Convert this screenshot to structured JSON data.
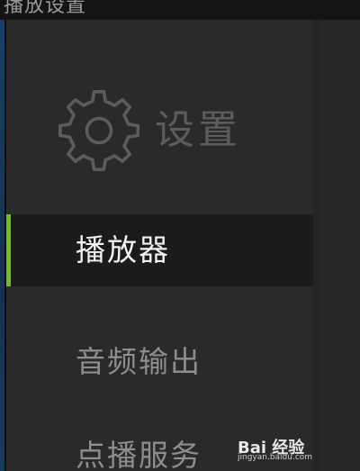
{
  "window": {
    "title": "播放设置"
  },
  "header": {
    "icon": "gear-icon",
    "title": "设置"
  },
  "sidebar": {
    "items": [
      {
        "label": "播放器",
        "active": true
      },
      {
        "label": "音频输出",
        "active": false
      },
      {
        "label": "点播服务",
        "active": false
      }
    ]
  },
  "colors": {
    "accent": "#6fbe1e",
    "panel": "#2a2a2a",
    "active_row": "#1b1b1b",
    "active_text": "#f2f2f2",
    "inactive_text": "#8e8e8e"
  },
  "watermark": {
    "logo": "Bai 经验",
    "url": "jingyan.baidu.com"
  }
}
